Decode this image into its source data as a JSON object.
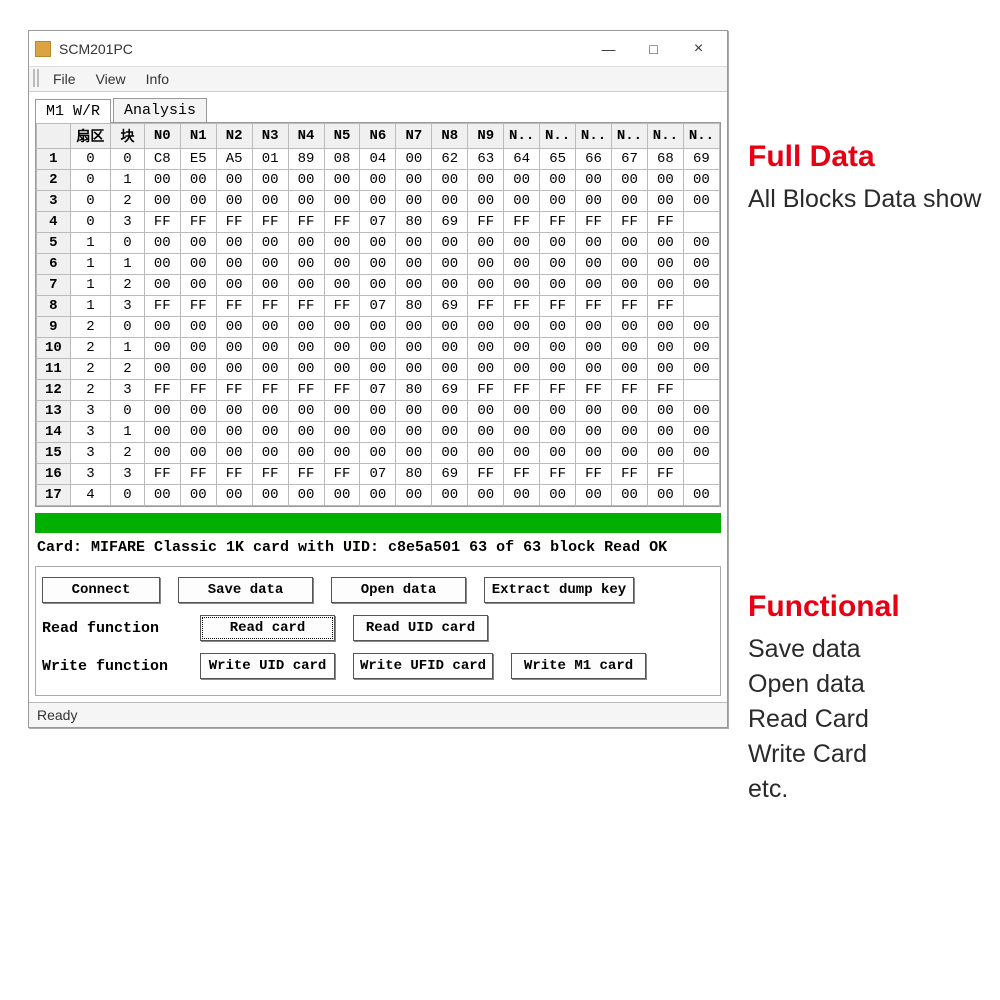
{
  "window": {
    "title": "SCM201PC",
    "minimize": "—",
    "maximize": "□",
    "close": "×"
  },
  "menu": {
    "file": "File",
    "view": "View",
    "info": "Info"
  },
  "tabs": {
    "m1wr": "M1 W/R",
    "analysis": "Analysis"
  },
  "grid": {
    "headers": [
      "",
      "扇区",
      "块",
      "N0",
      "N1",
      "N2",
      "N3",
      "N4",
      "N5",
      "N6",
      "N7",
      "N8",
      "N9",
      "N..",
      "N..",
      "N..",
      "N..",
      "N..",
      "N.."
    ],
    "rows": [
      {
        "idx": "1",
        "sec": "0",
        "blk": "0",
        "d": [
          "C8",
          "E5",
          "A5",
          "01",
          "89",
          "08",
          "04",
          "00",
          "62",
          "63",
          "64",
          "65",
          "66",
          "67",
          "68",
          "69"
        ]
      },
      {
        "idx": "2",
        "sec": "0",
        "blk": "1",
        "d": [
          "00",
          "00",
          "00",
          "00",
          "00",
          "00",
          "00",
          "00",
          "00",
          "00",
          "00",
          "00",
          "00",
          "00",
          "00",
          "00"
        ]
      },
      {
        "idx": "3",
        "sec": "0",
        "blk": "2",
        "d": [
          "00",
          "00",
          "00",
          "00",
          "00",
          "00",
          "00",
          "00",
          "00",
          "00",
          "00",
          "00",
          "00",
          "00",
          "00",
          "00"
        ]
      },
      {
        "idx": "4",
        "sec": "0",
        "blk": "3",
        "d": [
          "FF",
          "FF",
          "FF",
          "FF",
          "FF",
          "FF",
          "07",
          "80",
          "69",
          "FF",
          "FF",
          "FF",
          "FF",
          "FF",
          "FF"
        ]
      },
      {
        "idx": "5",
        "sec": "1",
        "blk": "0",
        "d": [
          "00",
          "00",
          "00",
          "00",
          "00",
          "00",
          "00",
          "00",
          "00",
          "00",
          "00",
          "00",
          "00",
          "00",
          "00",
          "00"
        ]
      },
      {
        "idx": "6",
        "sec": "1",
        "blk": "1",
        "d": [
          "00",
          "00",
          "00",
          "00",
          "00",
          "00",
          "00",
          "00",
          "00",
          "00",
          "00",
          "00",
          "00",
          "00",
          "00",
          "00"
        ]
      },
      {
        "idx": "7",
        "sec": "1",
        "blk": "2",
        "d": [
          "00",
          "00",
          "00",
          "00",
          "00",
          "00",
          "00",
          "00",
          "00",
          "00",
          "00",
          "00",
          "00",
          "00",
          "00",
          "00"
        ]
      },
      {
        "idx": "8",
        "sec": "1",
        "blk": "3",
        "d": [
          "FF",
          "FF",
          "FF",
          "FF",
          "FF",
          "FF",
          "07",
          "80",
          "69",
          "FF",
          "FF",
          "FF",
          "FF",
          "FF",
          "FF"
        ]
      },
      {
        "idx": "9",
        "sec": "2",
        "blk": "0",
        "d": [
          "00",
          "00",
          "00",
          "00",
          "00",
          "00",
          "00",
          "00",
          "00",
          "00",
          "00",
          "00",
          "00",
          "00",
          "00",
          "00"
        ]
      },
      {
        "idx": "10",
        "sec": "2",
        "blk": "1",
        "d": [
          "00",
          "00",
          "00",
          "00",
          "00",
          "00",
          "00",
          "00",
          "00",
          "00",
          "00",
          "00",
          "00",
          "00",
          "00",
          "00"
        ]
      },
      {
        "idx": "11",
        "sec": "2",
        "blk": "2",
        "d": [
          "00",
          "00",
          "00",
          "00",
          "00",
          "00",
          "00",
          "00",
          "00",
          "00",
          "00",
          "00",
          "00",
          "00",
          "00",
          "00"
        ]
      },
      {
        "idx": "12",
        "sec": "2",
        "blk": "3",
        "d": [
          "FF",
          "FF",
          "FF",
          "FF",
          "FF",
          "FF",
          "07",
          "80",
          "69",
          "FF",
          "FF",
          "FF",
          "FF",
          "FF",
          "FF"
        ]
      },
      {
        "idx": "13",
        "sec": "3",
        "blk": "0",
        "d": [
          "00",
          "00",
          "00",
          "00",
          "00",
          "00",
          "00",
          "00",
          "00",
          "00",
          "00",
          "00",
          "00",
          "00",
          "00",
          "00"
        ]
      },
      {
        "idx": "14",
        "sec": "3",
        "blk": "1",
        "d": [
          "00",
          "00",
          "00",
          "00",
          "00",
          "00",
          "00",
          "00",
          "00",
          "00",
          "00",
          "00",
          "00",
          "00",
          "00",
          "00"
        ]
      },
      {
        "idx": "15",
        "sec": "3",
        "blk": "2",
        "d": [
          "00",
          "00",
          "00",
          "00",
          "00",
          "00",
          "00",
          "00",
          "00",
          "00",
          "00",
          "00",
          "00",
          "00",
          "00",
          "00"
        ]
      },
      {
        "idx": "16",
        "sec": "3",
        "blk": "3",
        "d": [
          "FF",
          "FF",
          "FF",
          "FF",
          "FF",
          "FF",
          "07",
          "80",
          "69",
          "FF",
          "FF",
          "FF",
          "FF",
          "FF",
          "FF"
        ]
      },
      {
        "idx": "17",
        "sec": "4",
        "blk": "0",
        "d": [
          "00",
          "00",
          "00",
          "00",
          "00",
          "00",
          "00",
          "00",
          "00",
          "00",
          "00",
          "00",
          "00",
          "00",
          "00",
          "00"
        ]
      }
    ]
  },
  "status_card": "Card: MIFARE Classic 1K card with UID: c8e5a501 63 of 63 block Read OK",
  "buttons": {
    "connect": "Connect",
    "save_data": "Save data",
    "open_data": "Open data",
    "extract_dump_key": "Extract dump key",
    "read_function": "Read function",
    "read_card": "Read card",
    "read_uid_card": "Read UID card",
    "write_function": "Write function",
    "write_uid_card": "Write UID card",
    "write_ufid_card": "Write UFID card",
    "write_m1_card": "Write M1 card"
  },
  "statusbar": "Ready",
  "anno": {
    "full_data_title": "Full Data",
    "full_data_body": "All Blocks Data show",
    "functional_title": "Functional",
    "functional_body": "Save data\nOpen data\nRead Card\nWrite Card\netc."
  }
}
